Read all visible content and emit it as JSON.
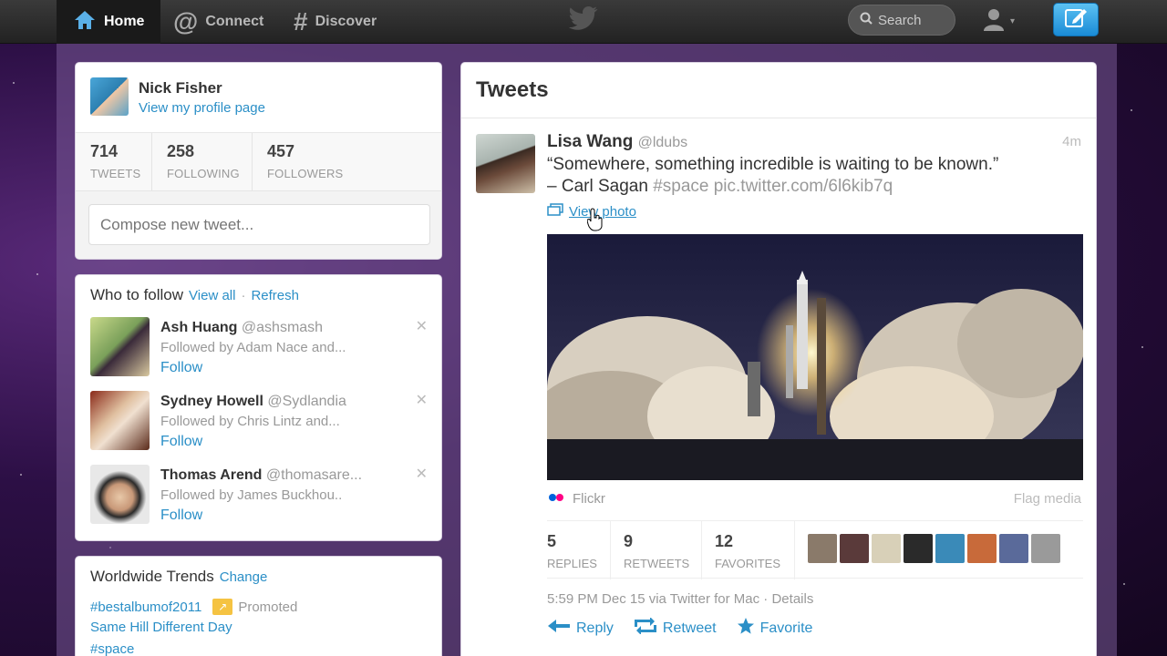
{
  "nav": {
    "home": "Home",
    "connect": "Connect",
    "discover": "Discover",
    "search_label": "Search",
    "icons": [
      "home-icon",
      "at-icon",
      "hash-icon",
      "twitter-bird-icon",
      "search-icon",
      "user-icon",
      "compose-icon"
    ]
  },
  "profile": {
    "name": "Nick Fisher",
    "link": "View my profile page",
    "stats": [
      {
        "value": "714",
        "label": "TWEETS"
      },
      {
        "value": "258",
        "label": "FOLLOWING"
      },
      {
        "value": "457",
        "label": "FOLLOWERS"
      }
    ],
    "compose_placeholder": "Compose new tweet..."
  },
  "who_to_follow": {
    "title": "Who to follow",
    "view_all": "View all",
    "separator": "·",
    "refresh": "Refresh",
    "items": [
      {
        "name": "Ash Huang",
        "handle": "@ashsmash",
        "followed_by": "Followed by Adam Nace and...",
        "follow": "Follow",
        "close": "✕"
      },
      {
        "name": "Sydney Howell",
        "handle": "@Sydlandia",
        "followed_by": "Followed by Chris Lintz and...",
        "follow": "Follow",
        "close": "✕"
      },
      {
        "name": "Thomas Arend",
        "handle": "@thomasare...",
        "followed_by": "Followed by James Buckhou..",
        "follow": "Follow",
        "close": "✕"
      }
    ]
  },
  "trends": {
    "title": "Worldwide Trends",
    "change": "Change",
    "items": [
      {
        "text": "#bestalbumof2011",
        "promoted": "Promoted"
      },
      {
        "text": "Same Hill Different Day"
      },
      {
        "text": "#space"
      }
    ]
  },
  "tweets": {
    "title": "Tweets",
    "tweet": {
      "name": "Lisa Wang",
      "handle": "@ldubs",
      "time": "4m",
      "line1": "“Somewhere, something incredible is waiting to be known.”",
      "line2_author": "– Carl Sagan",
      "line2_tags": "#space pic.twitter.com/6l6kib7q",
      "view_photo": "View photo",
      "source": "Flickr",
      "flag": "Flag media",
      "stats": [
        {
          "value": "5",
          "label": "REPLIES"
        },
        {
          "value": "9",
          "label": "RETWEETS"
        },
        {
          "value": "12",
          "label": "FAVORITES"
        }
      ],
      "meta": "5:59 PM Dec 15 via Twitter for Mac · Details",
      "actions": {
        "reply": "Reply",
        "retweet": "Retweet",
        "favorite": "Favorite"
      }
    }
  },
  "colors": {
    "link": "#2b8fc7",
    "compose": "#1a8bd6",
    "promoted": "#f5c342"
  }
}
